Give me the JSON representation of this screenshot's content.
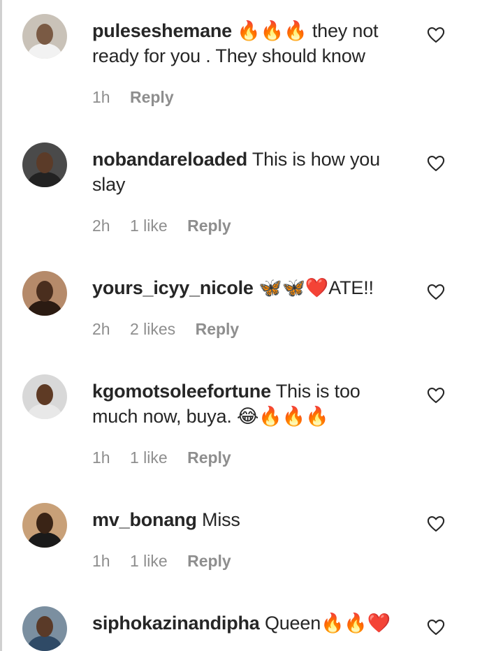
{
  "comments": [
    {
      "username": "puleseshemane",
      "text": " 🔥🔥🔥 they not ready for you . They should know",
      "time": "1h",
      "likes": "",
      "reply": "Reply",
      "avatar_colors": {
        "bg": "#c9c2b8",
        "face": "#7a5a44",
        "body": "#f2f2f2"
      }
    },
    {
      "username": "nobandareloaded",
      "text": " This is how you slay",
      "time": "2h",
      "likes": "1 like",
      "reply": "Reply",
      "avatar_colors": {
        "bg": "#4a4a4a",
        "face": "#5b3b28",
        "body": "#222222"
      }
    },
    {
      "username": "yours_icyy_nicole",
      "text": " 🦋🦋❤️ATE!!",
      "time": "2h",
      "likes": "2 likes",
      "reply": "Reply",
      "avatar_colors": {
        "bg": "#b58a6a",
        "face": "#4a2e1e",
        "body": "#2b1b12"
      }
    },
    {
      "username": "kgomotsoleefortune",
      "text": " This is too much now, buya. 😂🔥🔥🔥",
      "time": "1h",
      "likes": "1 like",
      "reply": "Reply",
      "avatar_colors": {
        "bg": "#d8d8d8",
        "face": "#5e3a24",
        "body": "#e8e8e8"
      }
    },
    {
      "username": "mv_bonang",
      "text": " Miss",
      "time": "1h",
      "likes": "1 like",
      "reply": "Reply",
      "avatar_colors": {
        "bg": "#c8a078",
        "face": "#3a2416",
        "body": "#1a1a1a"
      }
    },
    {
      "username": "siphokazinandipha",
      "text": " Queen🔥🔥❤️",
      "time": "",
      "likes": "",
      "reply": "",
      "avatar_colors": {
        "bg": "#7b8fa0",
        "face": "#5a3a28",
        "body": "#2f4a66"
      }
    }
  ]
}
